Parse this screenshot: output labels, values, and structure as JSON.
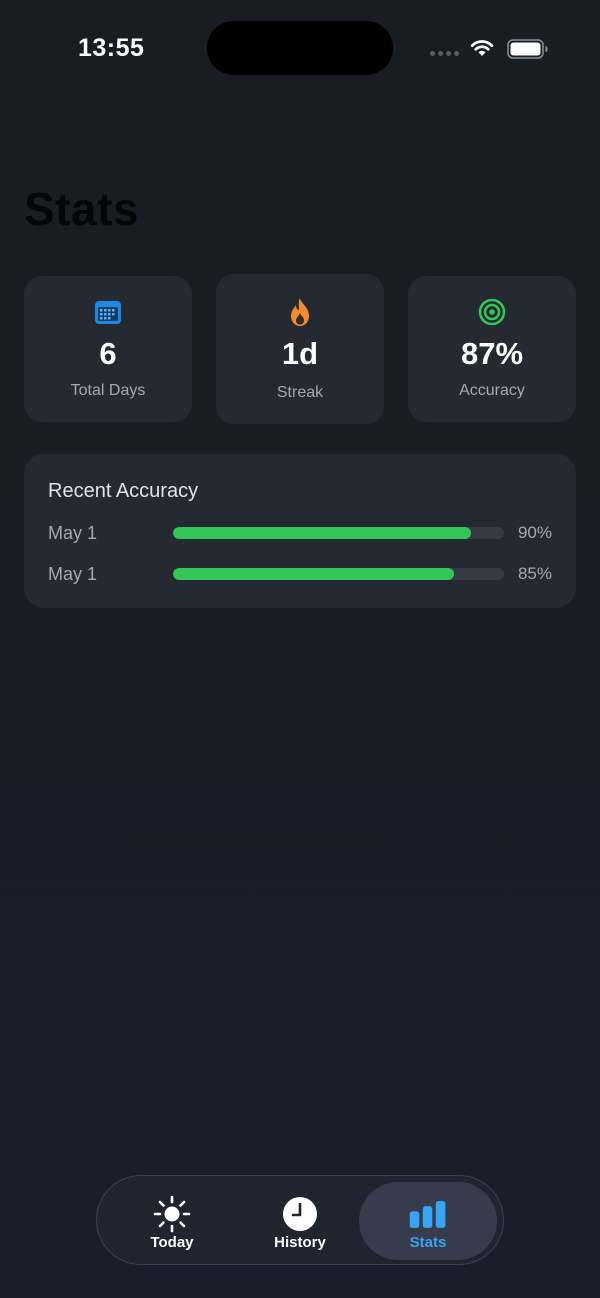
{
  "status_bar": {
    "time": "13:55"
  },
  "page_title": "Stats",
  "stats": [
    {
      "icon": "calendar-icon",
      "value": "6",
      "label": "Total Days",
      "icon_color": "#1e88e5"
    },
    {
      "icon": "flame-icon",
      "value": "1d",
      "label": "Streak",
      "icon_color": "#f58a2d"
    },
    {
      "icon": "target-icon",
      "value": "87%",
      "label": "Accuracy",
      "icon_color": "#33c759"
    }
  ],
  "recent_accuracy": {
    "title": "Recent Accuracy",
    "rows": [
      {
        "date": "May 1",
        "percent_label": "90%",
        "value": 0.9
      },
      {
        "date": "May 1",
        "percent_label": "85%",
        "value": 0.85
      }
    ],
    "bar_color": "#33c759"
  },
  "tab_bar": {
    "tabs": [
      {
        "label": "Today",
        "icon": "sun-icon",
        "selected": false
      },
      {
        "label": "History",
        "icon": "clock-icon",
        "selected": false
      },
      {
        "label": "Stats",
        "icon": "bar-chart-icon",
        "selected": true
      }
    ],
    "accent_color": "#35a6f5"
  }
}
